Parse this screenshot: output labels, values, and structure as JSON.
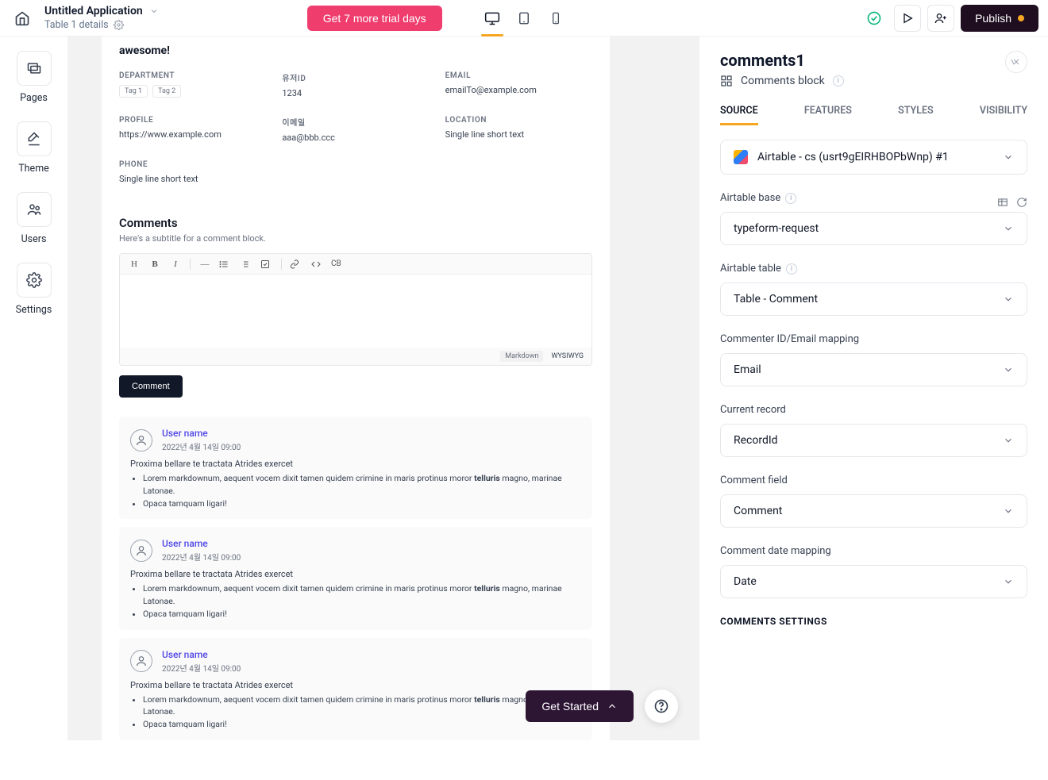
{
  "header": {
    "app_name": "Untitled Application",
    "subtitle": "Table 1 details",
    "trial_btn": "Get 7 more trial days",
    "publish": "Publish"
  },
  "leftnav": {
    "pages": "Pages",
    "theme": "Theme",
    "users": "Users",
    "settings": "Settings"
  },
  "preview": {
    "hero": "awesome!",
    "fields": {
      "department": {
        "label": "DEPARTMENT",
        "tag1": "Tag 1",
        "tag2": "Tag 2"
      },
      "userid": {
        "label": "유저ID",
        "value": "1234"
      },
      "email": {
        "label": "EMAIL",
        "value": "emailTo@example.com"
      },
      "profile": {
        "label": "PROFILE",
        "value": "https://www.example.com"
      },
      "imail": {
        "label": "이메일",
        "value": "aaa@bbb.ccc"
      },
      "location": {
        "label": "LOCATION",
        "value": "Single line short text"
      },
      "phone": {
        "label": "PHONE",
        "value": "Single line short text"
      }
    },
    "comments_title": "Comments",
    "comments_sub": "Here's a subtitle for a comment block.",
    "toolbar": {
      "h": "H",
      "b": "B",
      "i": "I",
      "cb": "CB"
    },
    "editor_footer": {
      "md": "Markdown",
      "wys": "WYSIWYG"
    },
    "comment_btn": "Comment",
    "sample": {
      "name": "User name",
      "date": "2022년 4월 14일 09:00",
      "body_title": "Proxima bellare te tractata Atrides exercet",
      "li1_a": "Lorem markdownum, aequent vocem dixit tamen quidem crimine in maris protinus moror ",
      "li1_bold": "telluris",
      "li1_b": " magno, marinae Latonae.",
      "li2": "Opaca tamquam ligari!"
    },
    "get_started": "Get Started"
  },
  "rp": {
    "title": "comments1",
    "block_type": "Comments block",
    "tabs": {
      "source": "SOURCE",
      "features": "FEATURES",
      "styles": "STYLES",
      "visibility": "VISIBILITY"
    },
    "source_select": "Airtable - cs (usrt9gEIRHBOPbWnp) #1",
    "groups": {
      "base": {
        "label": "Airtable base",
        "value": "typeform-request"
      },
      "table": {
        "label": "Airtable table",
        "value": "Table - Comment"
      },
      "mapping": {
        "label": "Commenter ID/Email mapping",
        "value": "Email"
      },
      "record": {
        "label": "Current record",
        "value": "RecordId"
      },
      "field": {
        "label": "Comment field",
        "value": "Comment"
      },
      "date": {
        "label": "Comment date mapping",
        "value": "Date"
      }
    },
    "settings_header": "COMMENTS SETTINGS"
  }
}
